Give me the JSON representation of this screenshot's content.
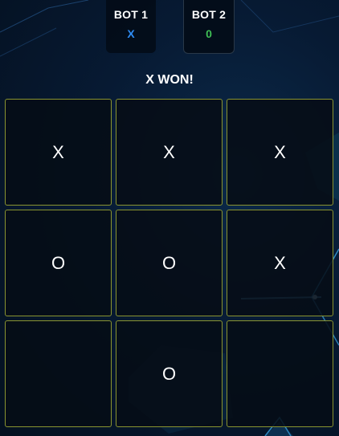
{
  "colors": {
    "x_accent": "#2f8df5",
    "o_accent": "#3fbf55",
    "cell_border": "#8a9430",
    "cell_background": "#060c16"
  },
  "scoreboard": {
    "players": [
      {
        "name": "BOT 1",
        "mark": "X"
      },
      {
        "name": "BOT 2",
        "mark": "0"
      }
    ]
  },
  "status": "X WON!",
  "board": {
    "cells": [
      {
        "mark": "X"
      },
      {
        "mark": "X"
      },
      {
        "mark": "X"
      },
      {
        "mark": "O"
      },
      {
        "mark": "O"
      },
      {
        "mark": "X"
      },
      {
        "mark": ""
      },
      {
        "mark": "O"
      },
      {
        "mark": ""
      }
    ]
  }
}
